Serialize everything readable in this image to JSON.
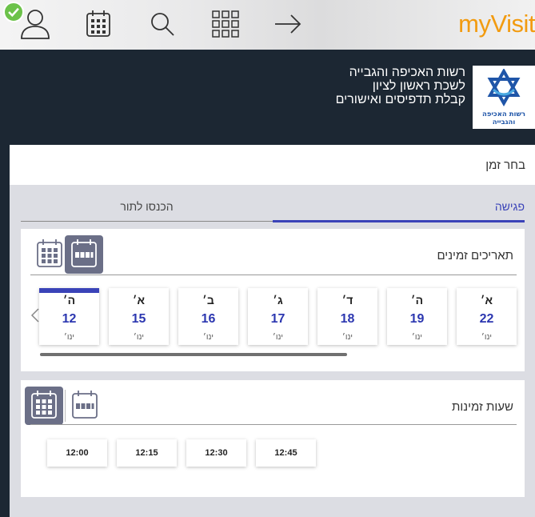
{
  "brand": {
    "name": "myVisit",
    "color": "#f29b10"
  },
  "nav": {
    "icons": [
      "user-icon",
      "calendar-icon",
      "search-icon",
      "grid-icon",
      "arrow-right-icon"
    ],
    "status": "check-icon"
  },
  "header": {
    "line1": "רשות האכיפה והגבייה",
    "line2": "לשכת ראשון לציון",
    "line3": "קבלת תדפיסים ואישורים",
    "logo_text_1": "רשות האכיפה",
    "logo_text_2": "והגבייה"
  },
  "choose_time": "בחר זמן",
  "tabs": {
    "meeting": "פגישה",
    "queue": "הכנסו לתור"
  },
  "dates_panel": {
    "title": "תאריכים זמינים",
    "dates": [
      {
        "dow": "א׳",
        "day": "22",
        "month": "ינו׳"
      },
      {
        "dow": "ה׳",
        "day": "19",
        "month": "ינו׳"
      },
      {
        "dow": "ד׳",
        "day": "18",
        "month": "ינו׳"
      },
      {
        "dow": "ג׳",
        "day": "17",
        "month": "ינו׳"
      },
      {
        "dow": "ב׳",
        "day": "16",
        "month": "ינו׳"
      },
      {
        "dow": "א׳",
        "day": "15",
        "month": "ינו׳"
      },
      {
        "dow": "ה׳",
        "day": "12",
        "month": "ינו׳"
      }
    ],
    "selected_index": 6
  },
  "times_panel": {
    "title": "שעות זמינות",
    "slots": [
      "12:45",
      "12:30",
      "12:15",
      "12:00"
    ]
  },
  "colors": {
    "accent": "#3a43b8",
    "header_bg": "#1c2733",
    "toggle_active": "#6b6f87"
  }
}
